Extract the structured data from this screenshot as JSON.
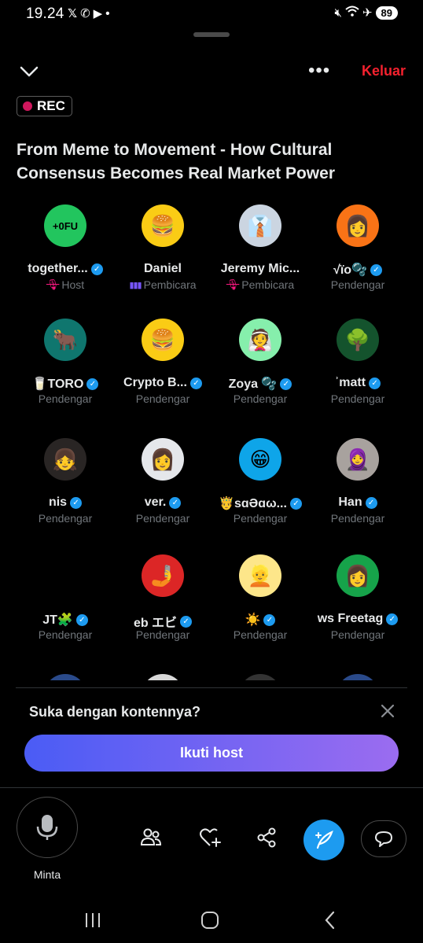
{
  "status_bar": {
    "time": "19.24",
    "apps": [
      "𝕏",
      "✆",
      "▶",
      "•"
    ],
    "battery": "89"
  },
  "header": {
    "leave_label": "Keluar",
    "rec_label": "REC"
  },
  "space": {
    "title": "From Meme to Movement - How Cultural Consensus Becomes Real Market Power"
  },
  "participants": [
    {
      "name": "together...",
      "role": "Host",
      "verified": true,
      "mic": "muted",
      "avatar_color": "#22c55e",
      "avatar_glyph": "+0FU"
    },
    {
      "name": "Daniel",
      "role": "Pembicara",
      "verified": false,
      "mic": "speaking",
      "avatar_color": "#facc15",
      "avatar_glyph": "🍔"
    },
    {
      "name": "Jeremy Mic...",
      "role": "Pembicara",
      "verified": false,
      "mic": "muted",
      "avatar_color": "#cbd5e1",
      "avatar_glyph": "👔"
    },
    {
      "name": "√ïo🫧",
      "role": "Pendengar",
      "verified": true,
      "mic": "none",
      "avatar_color": "#f97316",
      "avatar_glyph": "👩"
    },
    {
      "name": "🥛TORO",
      "role": "Pendengar",
      "verified": true,
      "mic": "none",
      "avatar_color": "#0f766e",
      "avatar_glyph": "🐂"
    },
    {
      "name": "Crypto B...",
      "role": "Pendengar",
      "verified": true,
      "mic": "none",
      "avatar_color": "#facc15",
      "avatar_glyph": "🍔"
    },
    {
      "name": "Zoya 🫧",
      "role": "Pendengar",
      "verified": true,
      "mic": "none",
      "avatar_color": "#86efac",
      "avatar_glyph": "👰"
    },
    {
      "name": "ʾmatt",
      "role": "Pendengar",
      "verified": true,
      "mic": "none",
      "avatar_color": "#14532d",
      "avatar_glyph": "🌳"
    },
    {
      "name": "nis",
      "role": "Pendengar",
      "verified": true,
      "mic": "none",
      "avatar_color": "#292524",
      "avatar_glyph": "👧"
    },
    {
      "name": "ver.",
      "role": "Pendengar",
      "verified": true,
      "mic": "none",
      "avatar_color": "#e5e7eb",
      "avatar_glyph": "👩"
    },
    {
      "name": "🤴sɑƏɑω...",
      "role": "Pendengar",
      "verified": true,
      "mic": "none",
      "avatar_color": "#0ea5e9",
      "avatar_glyph": "😁"
    },
    {
      "name": "Han",
      "role": "Pendengar",
      "verified": true,
      "mic": "none",
      "avatar_color": "#a8a29e",
      "avatar_glyph": "🧕"
    },
    {
      "name": "JT🧩",
      "role": "Pendengar",
      "verified": true,
      "mic": "none",
      "avatar_color": "#000000",
      "avatar_glyph": "😷"
    },
    {
      "name": "eb エビ",
      "role": "Pendengar",
      "verified": true,
      "mic": "none",
      "avatar_color": "#dc2626",
      "avatar_glyph": "🤳"
    },
    {
      "name": "☀️",
      "role": "Pendengar",
      "verified": true,
      "mic": "none",
      "avatar_color": "#fde68a",
      "avatar_glyph": "👱"
    },
    {
      "name": "ws Freetag",
      "role": "Pendengar",
      "verified": true,
      "mic": "none",
      "avatar_color": "#16a34a",
      "avatar_glyph": "👩"
    }
  ],
  "prompt": {
    "text": "Suka dengan kontennya?",
    "button": "Ikuti host"
  },
  "toolbar": {
    "mic_label": "Minta"
  }
}
